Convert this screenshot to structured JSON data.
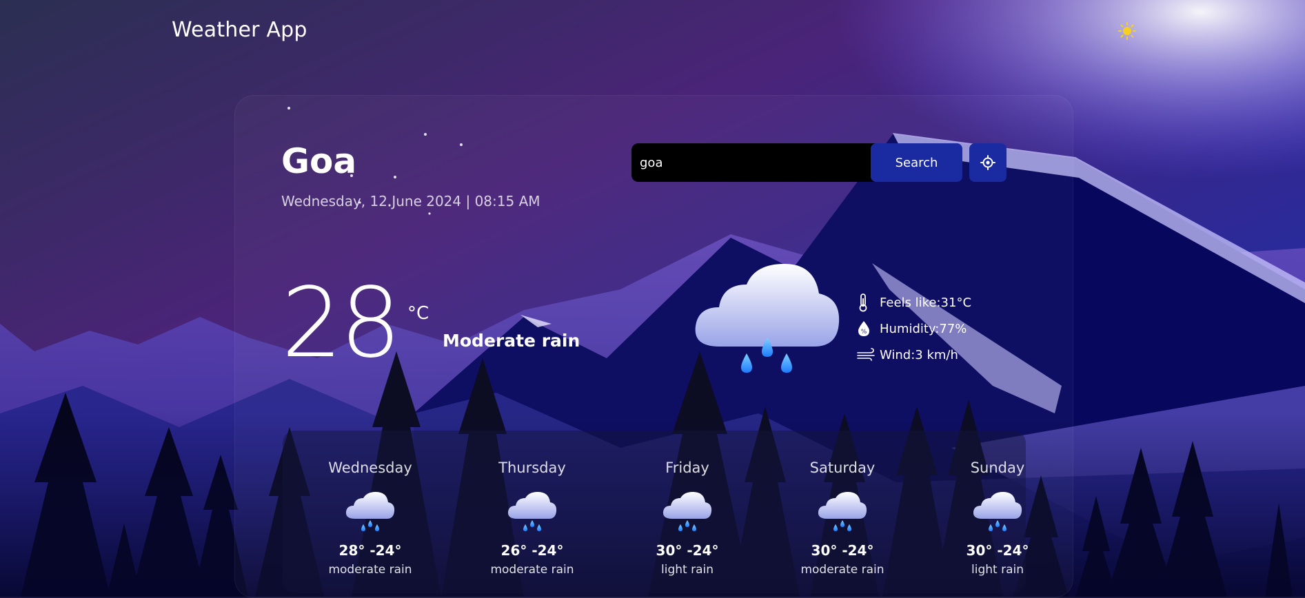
{
  "header": {
    "app_title": "Weather App",
    "theme_icon": "sun-icon",
    "theme_color": "#f5d020"
  },
  "location": {
    "city": "Goa",
    "datetime": "Wednesday, 12 June 2024 | 08:15 AM"
  },
  "search": {
    "value": "goa",
    "placeholder": "",
    "button_label": "Search",
    "locate_icon": "crosshair-icon"
  },
  "current": {
    "temperature": "28",
    "unit": "°C",
    "condition": "Moderate rain",
    "icon": "rain-cloud-icon",
    "feels_like": "Feels like:31°C",
    "humidity": "Humidity:77%",
    "wind": "Wind:3 km/h"
  },
  "forecast": [
    {
      "day": "Wednesday",
      "temp": "28° -24°",
      "desc": "moderate rain",
      "icon": "rain-cloud-icon"
    },
    {
      "day": "Thursday",
      "temp": "26° -24°",
      "desc": "moderate rain",
      "icon": "rain-cloud-icon"
    },
    {
      "day": "Friday",
      "temp": "30° -24°",
      "desc": "light rain",
      "icon": "rain-cloud-icon"
    },
    {
      "day": "Saturday",
      "temp": "30° -24°",
      "desc": "moderate rain",
      "icon": "rain-cloud-icon"
    },
    {
      "day": "Sunday",
      "temp": "30° -24°",
      "desc": "light rain",
      "icon": "rain-cloud-icon"
    }
  ],
  "colors": {
    "accent": "#1a2aa0",
    "search_bg": "#000000",
    "sky_top": "#3a2a6a",
    "sky_mid": "#4a2080",
    "mountain": "#07075e"
  }
}
